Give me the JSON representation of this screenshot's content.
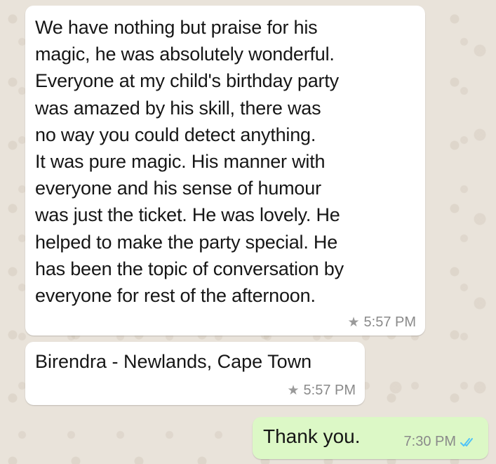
{
  "messages": [
    {
      "direction": "incoming",
      "lines": [
        "We have nothing but praise for his",
        "magic, he was absolutely wonderful.",
        "Everyone at my child's birthday party",
        "was amazed by his skill, there was",
        "no way you could detect anything.",
        "It was pure magic. His manner with",
        "everyone and his sense of humour",
        "was just the ticket. He was lovely. He",
        "helped to make the party special. He",
        "has been the topic of conversation by",
        "everyone for rest of the afternoon."
      ],
      "time": "5:57 PM",
      "starred": true
    },
    {
      "direction": "incoming",
      "text": "Birendra - Newlands, Cape Town",
      "time": "5:57 PM",
      "starred": true
    },
    {
      "direction": "outgoing",
      "text": "Thank you.",
      "time": "7:30 PM",
      "status": "read"
    }
  ],
  "colors": {
    "incoming_bubble": "#ffffff",
    "outgoing_bubble": "#dcf8c6",
    "read_ticks": "#4fc3f7",
    "wallpaper": "#e9e3da"
  },
  "icons": {
    "star": "star-icon",
    "ticks": "double-check-icon"
  }
}
